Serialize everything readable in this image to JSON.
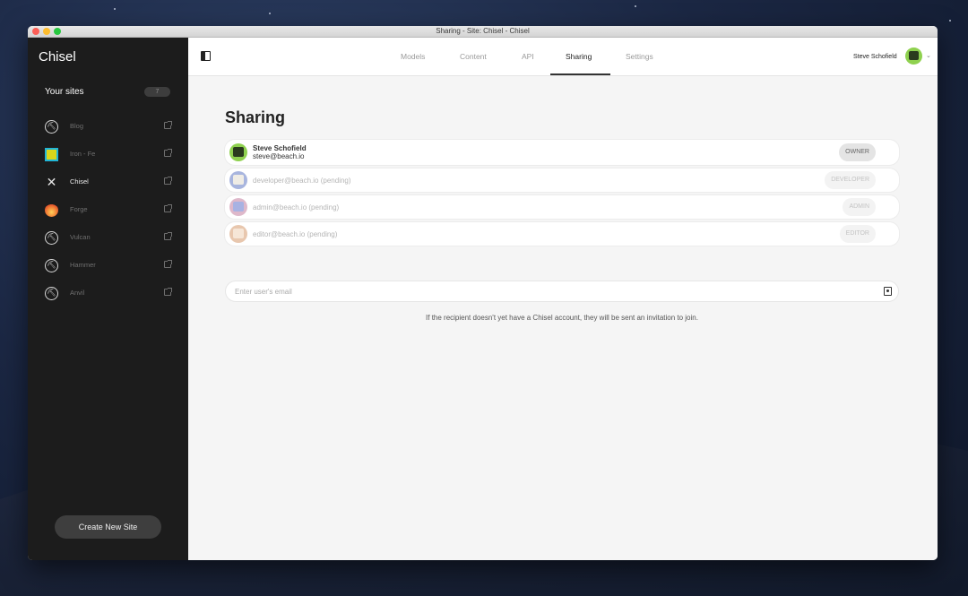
{
  "window": {
    "title": "Sharing - Site: Chisel - Chisel"
  },
  "sidebar": {
    "brand": "Chisel",
    "your_sites_label": "Your sites",
    "site_count": "7",
    "sites": [
      {
        "name": "Blog",
        "icon": "pickaxe-icon",
        "active": false
      },
      {
        "name": "Iron - Fe",
        "icon": "iron-square-icon",
        "active": false
      },
      {
        "name": "Chisel",
        "icon": "chisel-cross-icon",
        "active": true
      },
      {
        "name": "Forge",
        "icon": "forge-flame-icon",
        "active": false
      },
      {
        "name": "Vulcan",
        "icon": "pickaxe-icon",
        "active": false
      },
      {
        "name": "Hammer",
        "icon": "pickaxe-icon",
        "active": false
      },
      {
        "name": "Anvil",
        "icon": "pickaxe-icon",
        "active": false
      }
    ],
    "create_button": "Create New Site"
  },
  "topbar": {
    "tabs": [
      {
        "label": "Models",
        "active": false
      },
      {
        "label": "Content",
        "active": false
      },
      {
        "label": "API",
        "active": false
      },
      {
        "label": "Sharing",
        "active": true
      },
      {
        "label": "Settings",
        "active": false
      }
    ],
    "user_name": "Steve Schofield"
  },
  "main": {
    "title": "Sharing",
    "members": [
      {
        "name": "Steve Schofield",
        "email": "steve@beach.io",
        "role": "OWNER",
        "pending": false,
        "avatar_color": "#8fd14f"
      },
      {
        "label": "developer@beach.io (pending)",
        "role": "DEVELOPER",
        "pending": true,
        "avatar_color": "#6f84c9"
      },
      {
        "label": "admin@beach.io (pending)",
        "role": "ADMIN",
        "pending": true,
        "avatar_color": "#c98aa8"
      },
      {
        "label": "editor@beach.io (pending)",
        "role": "EDITOR",
        "pending": true,
        "avatar_color": "#d9a27a"
      }
    ],
    "invite_placeholder": "Enter user's email",
    "hint": "If the recipient doesn't yet have a Chisel account, they will be sent an invitation to join."
  },
  "colors": {
    "sidebar_bg": "#1c1c1c",
    "content_bg": "#f5f5f5",
    "accent": "#333333"
  }
}
